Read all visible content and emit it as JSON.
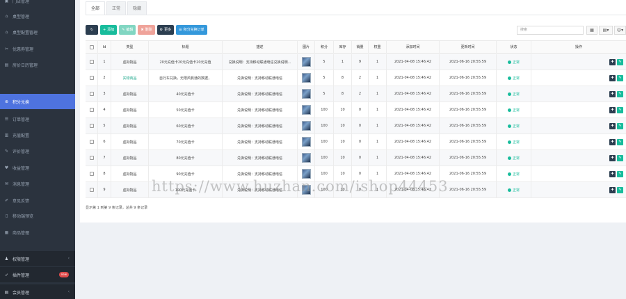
{
  "sidebar": {
    "items": [
      {
        "label": "门店管理",
        "icon": "store-icon",
        "glyph": "▣"
      },
      {
        "label": "桌型管理",
        "icon": "home-icon",
        "glyph": "⌂"
      },
      {
        "label": "桌型配置管理",
        "icon": "home-icon",
        "glyph": "⌂"
      },
      {
        "label": "优惠券管理",
        "icon": "ticket-icon",
        "glyph": "✂"
      },
      {
        "label": "房价日历管理",
        "icon": "calendar-icon",
        "glyph": "▤"
      },
      {
        "label": "积分兑换",
        "icon": "gift-icon",
        "glyph": "⊛",
        "active": true
      },
      {
        "label": "订单管理",
        "icon": "order-icon",
        "glyph": "☰"
      },
      {
        "label": "充值配置",
        "icon": "wallet-icon",
        "glyph": "▥"
      },
      {
        "label": "评价管理",
        "icon": "comment-icon",
        "glyph": "✎"
      },
      {
        "label": "收益管理",
        "icon": "heart-icon",
        "glyph": "♥"
      },
      {
        "label": "消息管理",
        "icon": "message-icon",
        "glyph": "✉"
      },
      {
        "label": "意见反馈",
        "icon": "edit-icon",
        "glyph": "✐"
      },
      {
        "label": "移动端预览",
        "icon": "mobile-icon",
        "glyph": "▯"
      },
      {
        "label": "商品管理",
        "icon": "goods-icon",
        "glyph": "▦"
      },
      {
        "label": "权限管理",
        "icon": "group-icon",
        "glyph": "♟",
        "section": true,
        "caret": "‹"
      },
      {
        "label": "插件管理",
        "icon": "rocket-icon",
        "glyph": "➶",
        "section": true,
        "badge": "new"
      },
      {
        "label": "会员管理",
        "icon": "members-icon",
        "glyph": "▤",
        "section": true,
        "caret": "‹"
      }
    ]
  },
  "tabs": [
    "全部",
    "正常",
    "隐藏"
  ],
  "toolbar": {
    "add": "添加",
    "edit": "编辑",
    "delete": "删除",
    "more": "更多",
    "export": "积分兑换订单",
    "search_placeholder": "搜索"
  },
  "table": {
    "headers": [
      "",
      "Id",
      "类型",
      "标题",
      "描述",
      "图片",
      "积分",
      "库存",
      "销量",
      "权重",
      "添加时间",
      "更新时间",
      "状态",
      "操作"
    ],
    "rows": [
      {
        "id": "1",
        "type": "虚拟物品",
        "title": "20元充值卡20元充值卡20元充值",
        "desc": "兑换说明：支持移动联通电信兑换说明...",
        "points": "5",
        "stock": "1",
        "sales": "9",
        "weight": "1",
        "created": "2021-04-08 15:46:42",
        "updated": "2021-06-16 20:55:59",
        "status": "正常"
      },
      {
        "id": "2",
        "type": "实物商品",
        "title": "自行车兑换，无限风帆通的数据，",
        "desc": "兑换说明：支持移动联通电信",
        "points": "5",
        "stock": "8",
        "sales": "2",
        "weight": "1",
        "created": "2021-04-08 15:46:42",
        "updated": "2021-06-16 20:55:59",
        "status": "正常"
      },
      {
        "id": "3",
        "type": "虚拟物品",
        "title": "40元充值卡",
        "desc": "兑换说明：支持移动联通电信",
        "points": "5",
        "stock": "8",
        "sales": "2",
        "weight": "1",
        "created": "2021-04-08 15:46:42",
        "updated": "2021-06-16 20:55:59",
        "status": "正常"
      },
      {
        "id": "4",
        "type": "虚拟物品",
        "title": "50元充值卡",
        "desc": "兑换说明：支持移动联通电信",
        "points": "100",
        "stock": "10",
        "sales": "0",
        "weight": "1",
        "created": "2021-04-08 15:46:42",
        "updated": "2021-06-16 20:55:59",
        "status": "正常"
      },
      {
        "id": "5",
        "type": "虚拟物品",
        "title": "60元充值卡",
        "desc": "兑换说明：支持移动联通电信",
        "points": "100",
        "stock": "10",
        "sales": "0",
        "weight": "1",
        "created": "2021-04-08 15:46:42",
        "updated": "2021-06-16 20:55:59",
        "status": "正常"
      },
      {
        "id": "6",
        "type": "虚拟物品",
        "title": "70元充值卡",
        "desc": "兑换说明：支持移动联通电信",
        "points": "100",
        "stock": "10",
        "sales": "0",
        "weight": "1",
        "created": "2021-04-08 15:46:42",
        "updated": "2021-06-16 20:55:59",
        "status": "正常"
      },
      {
        "id": "7",
        "type": "虚拟物品",
        "title": "80元充值卡",
        "desc": "兑换说明：支持移动联通电信",
        "points": "100",
        "stock": "10",
        "sales": "0",
        "weight": "1",
        "created": "2021-04-08 15:46:42",
        "updated": "2021-06-16 20:55:59",
        "status": "正常"
      },
      {
        "id": "8",
        "type": "虚拟物品",
        "title": "90元充值卡",
        "desc": "兑换说明：支持移动联通电信",
        "points": "100",
        "stock": "10",
        "sales": "0",
        "weight": "1",
        "created": "2021-04-08 15:46:42",
        "updated": "2021-06-16 20:55:59",
        "status": "正常"
      },
      {
        "id": "9",
        "type": "虚拟物品",
        "title": "100元充值卡",
        "desc": "兑换说明：支持移动联通电信",
        "points": "100",
        "stock": "10",
        "sales": "0",
        "weight": "1",
        "created": "2021-04-08 15:46:42",
        "updated": "2021-06-16 20:55:59",
        "status": "正常"
      }
    ]
  },
  "footer": "显示第 1 到第 9 条记录，总共 9 条记录",
  "watermark": "https://www.huzhan.com/ishop44453",
  "colors": {
    "sidebar_bg": "#2b333e",
    "active_bg": "#4e73df",
    "status_ok": "#18bc9c",
    "add_green": "#18bc9c",
    "export_blue": "#3498db"
  }
}
